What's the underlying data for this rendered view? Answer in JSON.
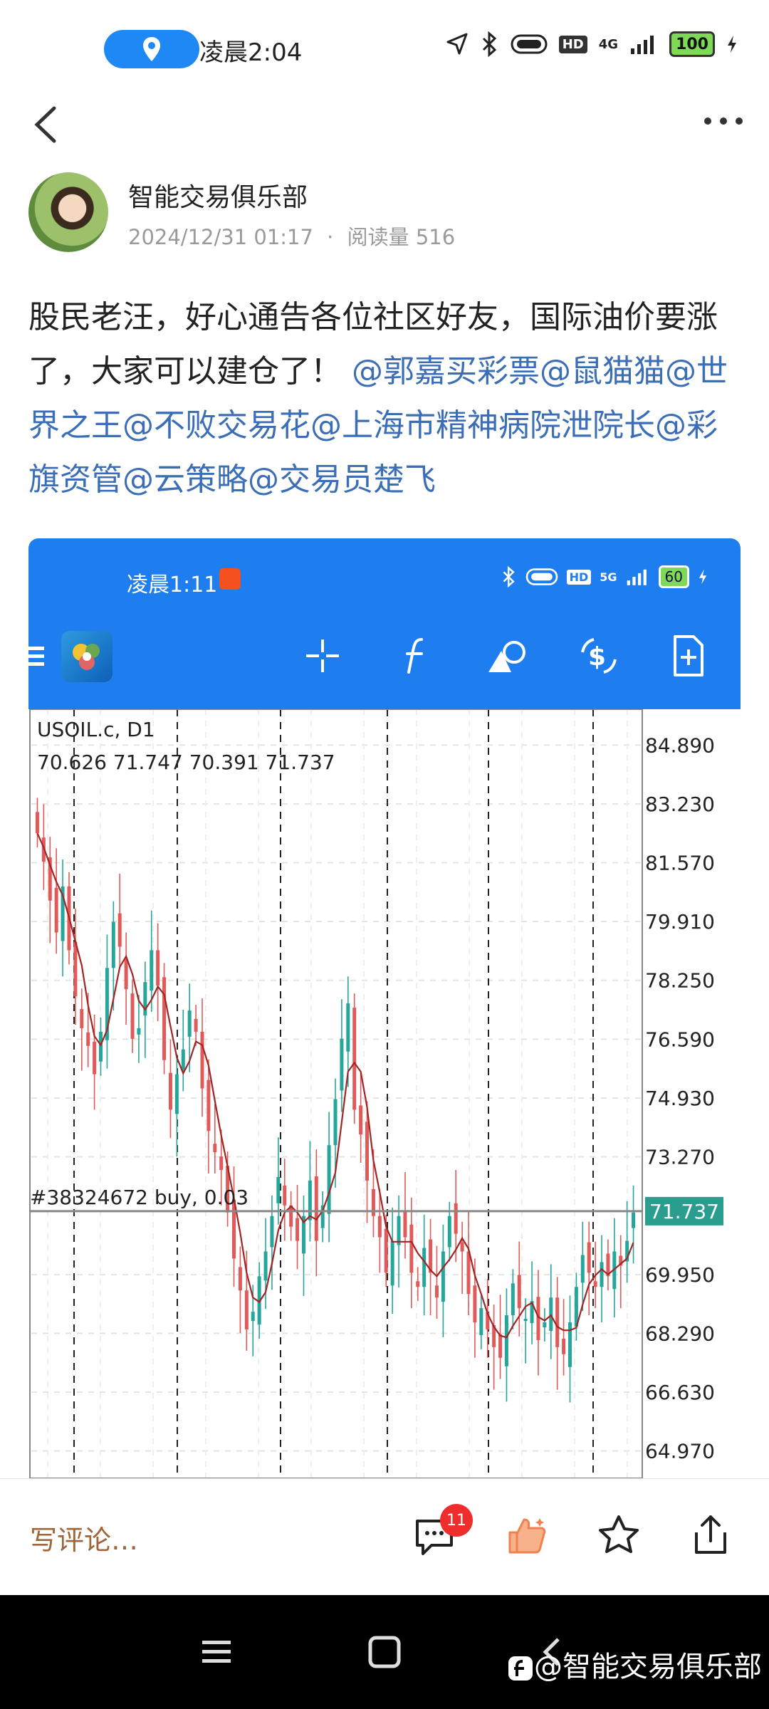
{
  "status_bar": {
    "time": "凌晨2:04",
    "network": "4G",
    "hd": "HD",
    "battery": "100"
  },
  "post": {
    "author": "智能交易俱乐部",
    "date": "2024/12/31 01:17",
    "separator": "·",
    "reads": "阅读量 516",
    "text": "股民老汪，好心通告各位社区好友，国际油价要涨了，大家可以建仓了！ ",
    "mentions": "@郭嘉买彩票@鼠猫猫@世界之王@不败交易花@上海市精神病院泄院长@彩旗资管@云策略@交易员楚飞"
  },
  "screenshot": {
    "time": "凌晨1:11",
    "network": "5G",
    "hd": "HD",
    "battery": "60",
    "symbol": "USOIL.c, D1",
    "ohlc": "70.626 71.747 70.391 71.737",
    "order_label": "#38324672 buy, 0.03",
    "current_price": "71.737",
    "price_ticks": [
      "84.890",
      "83.230",
      "81.570",
      "79.910",
      "78.250",
      "76.590",
      "74.930",
      "73.270",
      "69.950",
      "68.290",
      "66.630",
      "64.970"
    ]
  },
  "bottom_bar": {
    "comment_placeholder": "写评论…",
    "comment_count": "11"
  },
  "watermark": "@智能交易俱乐部",
  "colors": {
    "accent": "#1e7ef0",
    "mention": "#3b6eb6",
    "bull": "#26a69a",
    "bear": "#e05a5a",
    "ma": "#a32424",
    "price_tag": "#2a9d8f"
  },
  "chart_data": {
    "type": "candlestick",
    "symbol": "USOIL.c",
    "timeframe": "D1",
    "ylim": [
      64.2,
      85.9
    ],
    "current_price": 71.737,
    "y_ticks": [
      84.89,
      83.23,
      81.57,
      79.91,
      78.25,
      76.59,
      74.93,
      73.27,
      71.737,
      69.95,
      68.29,
      66.63,
      64.97
    ],
    "series_close": [
      82.4,
      81.6,
      80.5,
      79.6,
      80.9,
      79.1,
      77.8,
      76.9,
      76.4,
      75.6,
      76.8,
      78.6,
      79.9,
      79.2,
      78.0,
      76.6,
      76.9,
      78.2,
      79.1,
      78.1,
      76.0,
      74.6,
      75.6,
      76.3,
      77.4,
      76.8,
      75.2,
      74.0,
      73.4,
      72.9,
      71.7,
      70.4,
      69.5,
      68.4,
      68.9,
      69.9,
      70.6,
      71.6,
      72.7,
      71.9,
      71.3,
      70.9,
      71.6,
      72.6,
      70.9,
      71.9,
      73.6,
      74.9,
      76.6,
      77.6,
      74.6,
      73.9,
      72.6,
      71.6,
      71.0,
      70.0,
      70.9,
      71.6,
      71.0,
      70.0,
      69.6,
      70.7,
      70.0,
      69.3,
      70.6,
      71.6,
      71.1,
      70.6,
      69.4,
      68.6,
      69.0,
      68.4,
      67.9,
      67.6,
      68.8,
      69.7,
      69.0,
      68.7,
      69.2,
      68.1,
      68.6,
      69.3,
      67.9,
      67.7,
      68.6,
      69.6,
      70.5,
      70.0,
      69.6,
      70.3,
      69.9,
      70.6,
      70.2,
      70.9,
      71.7
    ]
  }
}
